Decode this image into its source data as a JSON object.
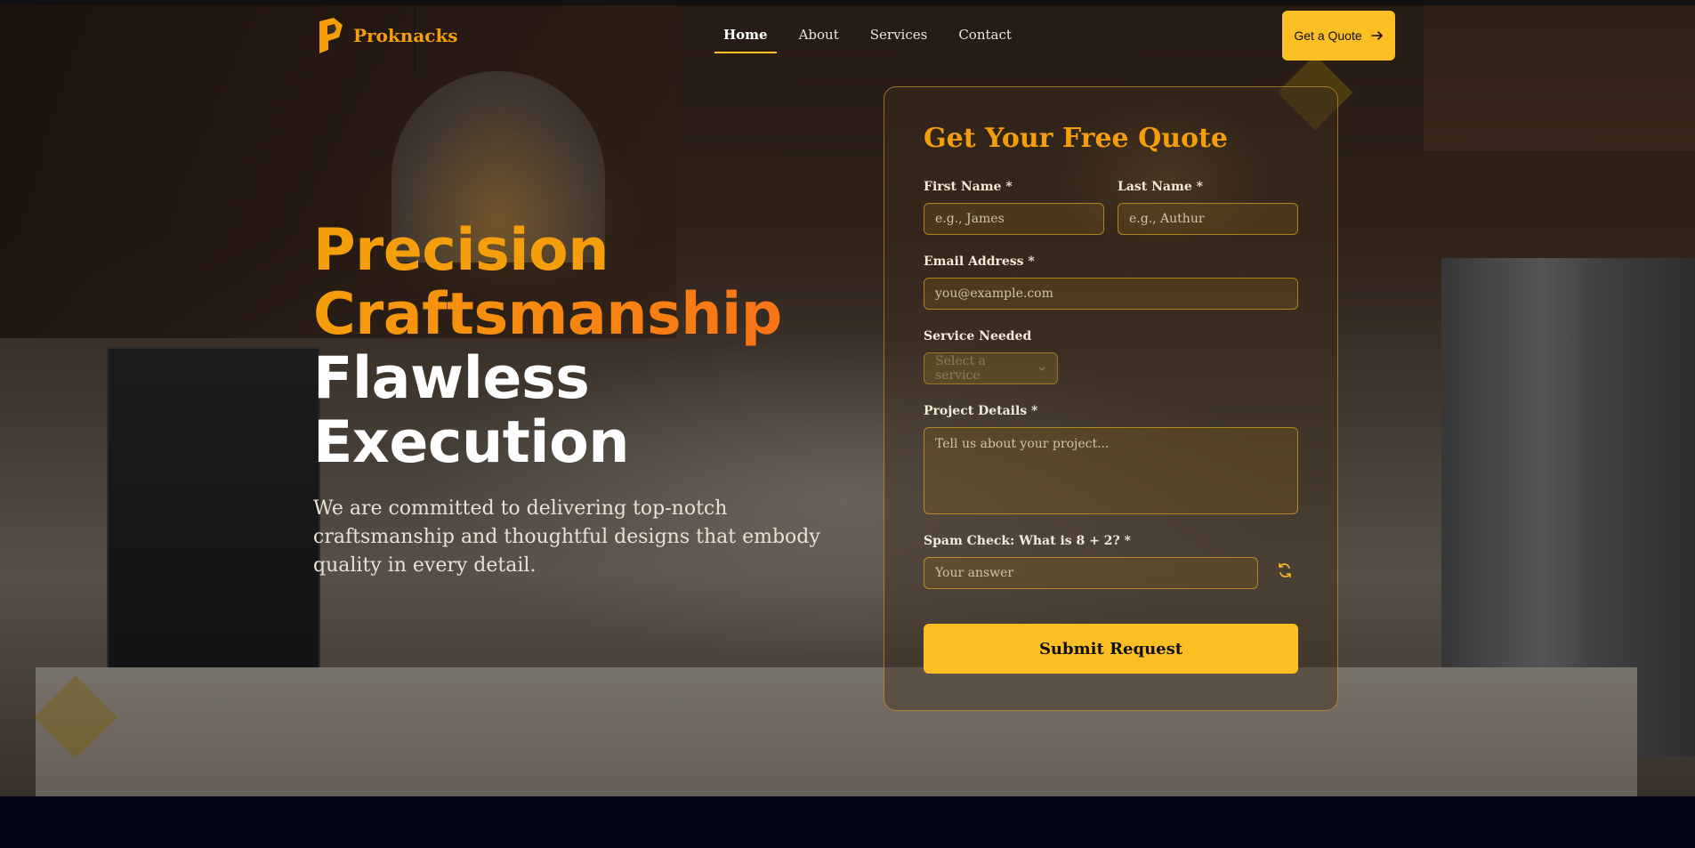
{
  "brand": {
    "name": "Proknacks",
    "logo_icon": "logo-mark",
    "accent": "#fbbf24",
    "accent_orange": "#f59e0b"
  },
  "nav": {
    "items": [
      {
        "label": "Home",
        "active": true
      },
      {
        "label": "About",
        "active": false
      },
      {
        "label": "Services",
        "active": false
      },
      {
        "label": "Contact",
        "active": false
      }
    ],
    "cta_label": "Get a Quote",
    "cta_icon": "arrow-right-icon"
  },
  "hero": {
    "line1": "Precision",
    "line2": "Craftsmanship",
    "line3": "Flawless",
    "line4": "Execution",
    "subtext": "We are committed to delivering top-notch craftsmanship and thoughtful designs that embody quality in every detail."
  },
  "form": {
    "title": "Get Your Free Quote",
    "first_name": {
      "label": "First Name *",
      "placeholder": "e.g., James",
      "value": ""
    },
    "last_name": {
      "label": "Last Name *",
      "placeholder": "e.g., Authur",
      "value": ""
    },
    "email": {
      "label": "Email Address *",
      "placeholder": "you@example.com",
      "value": ""
    },
    "service": {
      "label": "Service Needed",
      "selected": "Select a service"
    },
    "details": {
      "label": "Project Details *",
      "placeholder": "Tell us about your project...",
      "value": ""
    },
    "spam": {
      "label": "Spam Check: What is 8 + 2? *",
      "placeholder": "Your answer",
      "value": "",
      "refresh_icon": "refresh-icon"
    },
    "submit_label": "Submit Request"
  }
}
